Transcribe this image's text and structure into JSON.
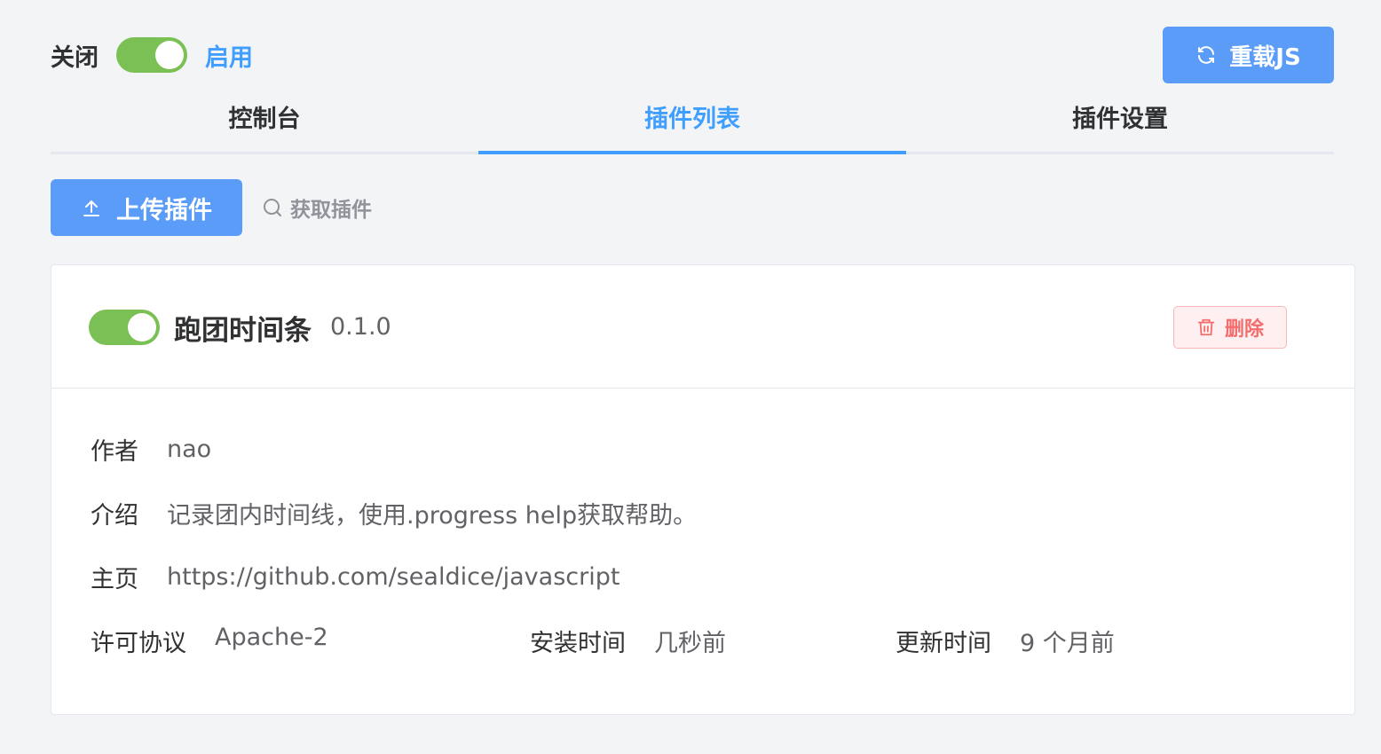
{
  "master_switch": {
    "off_label": "关闭",
    "on_label": "启用",
    "state": "on"
  },
  "reload_button": {
    "label": "重载JS",
    "icon": "refresh-icon"
  },
  "tabs": [
    {
      "label": "控制台",
      "active": false
    },
    {
      "label": "插件列表",
      "active": true
    },
    {
      "label": "插件设置",
      "active": false
    }
  ],
  "toolbar": {
    "upload_label": "上传插件",
    "upload_icon": "upload-icon",
    "fetch_label": "获取插件",
    "fetch_icon": "search-icon"
  },
  "plugin": {
    "enabled": true,
    "name": "跑团时间条",
    "version": "0.1.0",
    "delete_label": "删除",
    "delete_icon": "trash-icon",
    "author_label": "作者",
    "author": "nao",
    "desc_label": "介绍",
    "desc": "记录团内时间线，使用.progress help获取帮助。",
    "homepage_label": "主页",
    "homepage": "https://github.com/sealdice/javascript",
    "license_label": "许可协议",
    "license": "Apache-2",
    "installed_label": "安装时间",
    "installed": "几秒前",
    "updated_label": "更新时间",
    "updated": "9 个月前"
  },
  "colors": {
    "accent": "#409eff",
    "button_bg": "#5a9cf8",
    "switch_on": "#7ac054",
    "danger": "#f56c6c"
  }
}
